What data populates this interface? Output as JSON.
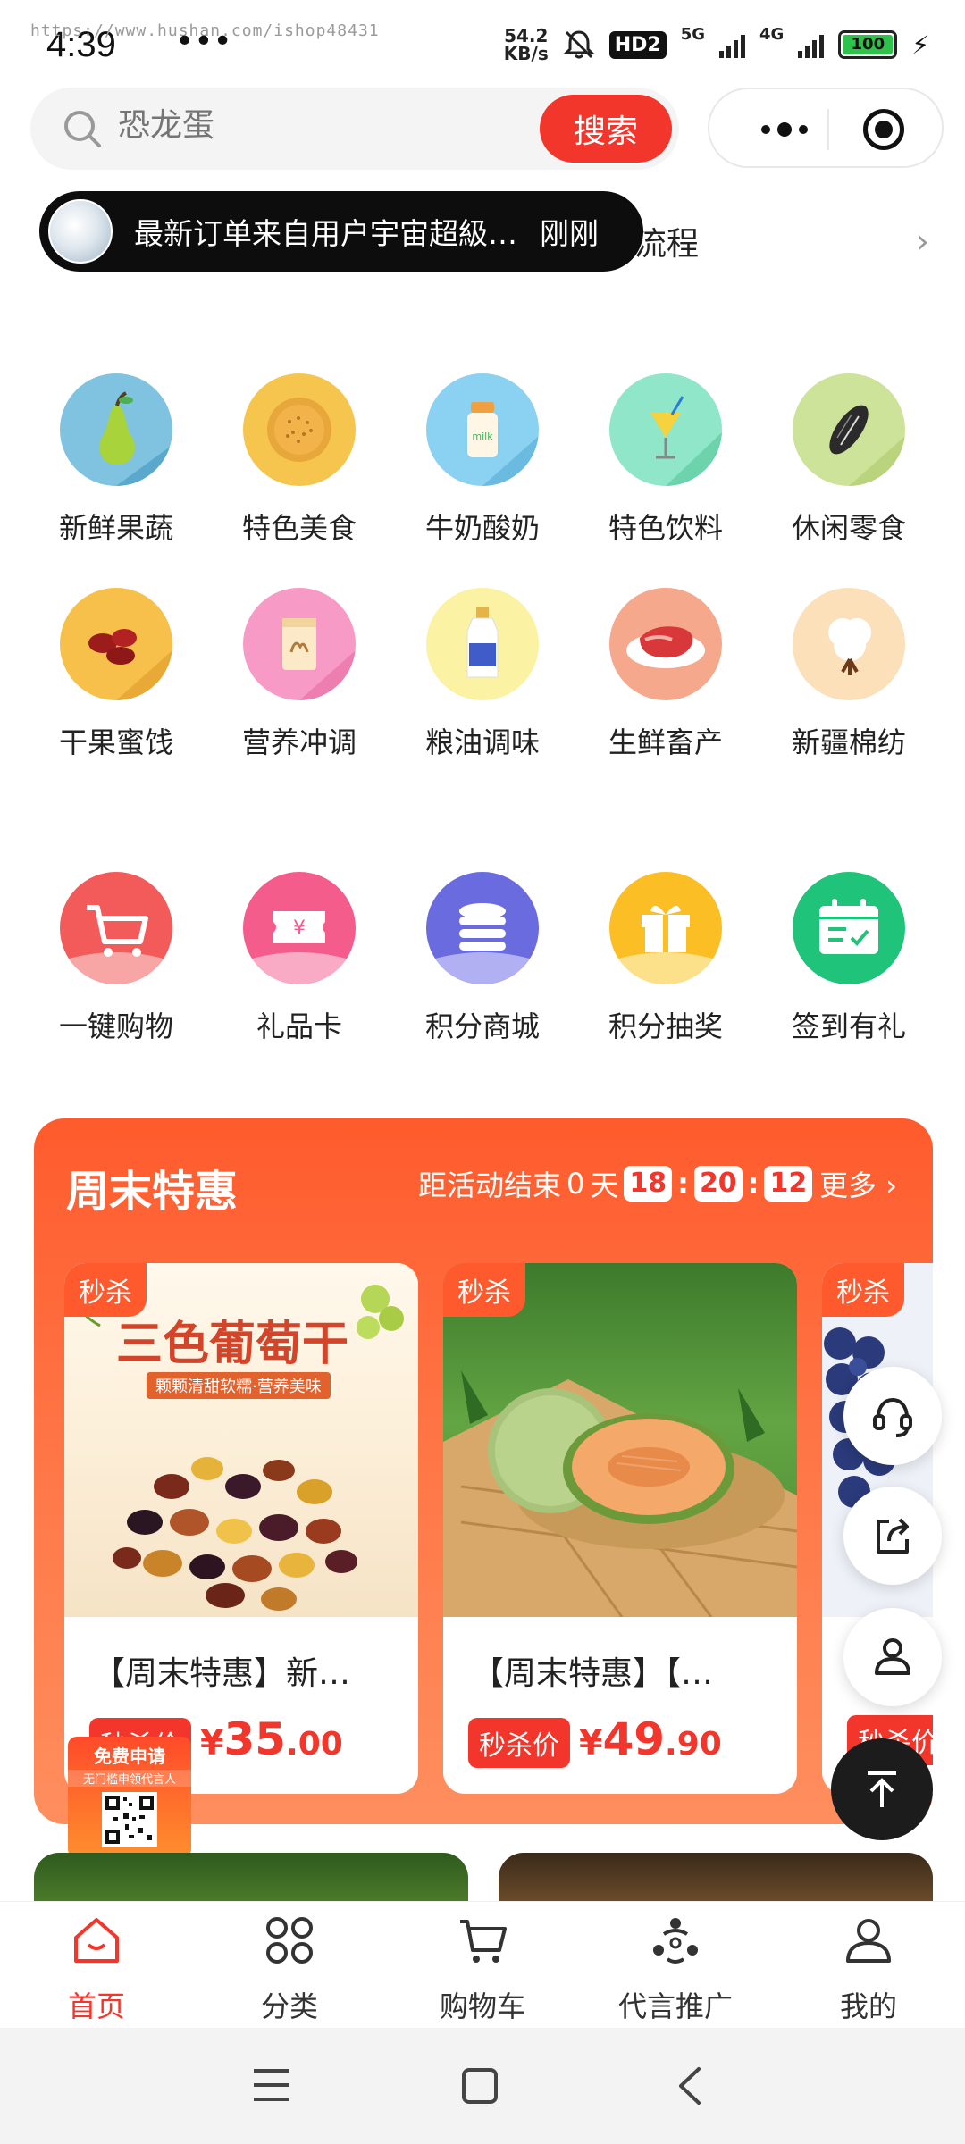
{
  "status_bar": {
    "time": "4:39",
    "url": "https://www.hushan.com/ishop48431",
    "dots": "•••",
    "speed_top": "54.2",
    "speed_bottom": "KB/s",
    "hd": "HD2",
    "net1": "5G",
    "net2": "4G",
    "battery": "100"
  },
  "search": {
    "placeholder": "恐龙蛋",
    "button": "搜索"
  },
  "notice": {
    "text": "流程",
    "order_text": "最新订单来自用户宇宙超級…",
    "order_time": "刚刚"
  },
  "categories": [
    {
      "label": "新鲜果蔬",
      "icon": "pear-icon"
    },
    {
      "label": "特色美食",
      "icon": "naan-bread-icon"
    },
    {
      "label": "牛奶酸奶",
      "icon": "milk-bottle-icon"
    },
    {
      "label": "特色饮料",
      "icon": "cocktail-icon"
    },
    {
      "label": "休闲零食",
      "icon": "sunflower-seed-icon"
    },
    {
      "label": "干果蜜饯",
      "icon": "red-dates-icon"
    },
    {
      "label": "营养冲调",
      "icon": "camel-milk-powder-icon"
    },
    {
      "label": "粮油调味",
      "icon": "oil-bottle-icon"
    },
    {
      "label": "生鲜畜产",
      "icon": "steak-icon"
    },
    {
      "label": "新疆棉纺",
      "icon": "cotton-icon"
    }
  ],
  "services": [
    {
      "label": "一键购物",
      "icon": "shopping-cart-icon",
      "color": "#f35a5a"
    },
    {
      "label": "礼品卡",
      "icon": "gift-card-icon",
      "color": "#f45c8c"
    },
    {
      "label": "积分商城",
      "icon": "coin-stack-icon",
      "color": "#6b6be0"
    },
    {
      "label": "积分抽奖",
      "icon": "gift-box-icon",
      "color": "#fbbf25"
    },
    {
      "label": "签到有礼",
      "icon": "calendar-check-icon",
      "color": "#1fc37a"
    }
  ],
  "weekend": {
    "title": "周末特惠",
    "countdown_label": "距活动结束",
    "days": "0",
    "days_unit": "天",
    "hours": "18",
    "minutes": "20",
    "seconds": "12",
    "more": "更多 ›",
    "products": [
      {
        "tag": "秒杀",
        "name": "【周末特惠】新…",
        "price_label": "秒杀价",
        "yen": "¥",
        "price_int": "35",
        "price_dec": ".00",
        "img_title": "三色葡萄干",
        "img_sub": "颗颗清甜软糯·营养美味"
      },
      {
        "tag": "秒杀",
        "name": "【周末特惠】【…",
        "price_label": "秒杀价",
        "yen": "¥",
        "price_int": "49",
        "price_dec": ".90"
      },
      {
        "tag": "秒杀",
        "price_label": "秒杀价"
      }
    ]
  },
  "promo": {
    "line1": "免费申请",
    "line2": "无门槛申领代言人"
  },
  "tabbar": [
    {
      "label": "首页",
      "active": true
    },
    {
      "label": "分类"
    },
    {
      "label": "购物车"
    },
    {
      "label": "代言推广"
    },
    {
      "label": "我的"
    }
  ],
  "colors": {
    "accent": "#f2362b",
    "weekend_bg": "#ff5b2d"
  }
}
